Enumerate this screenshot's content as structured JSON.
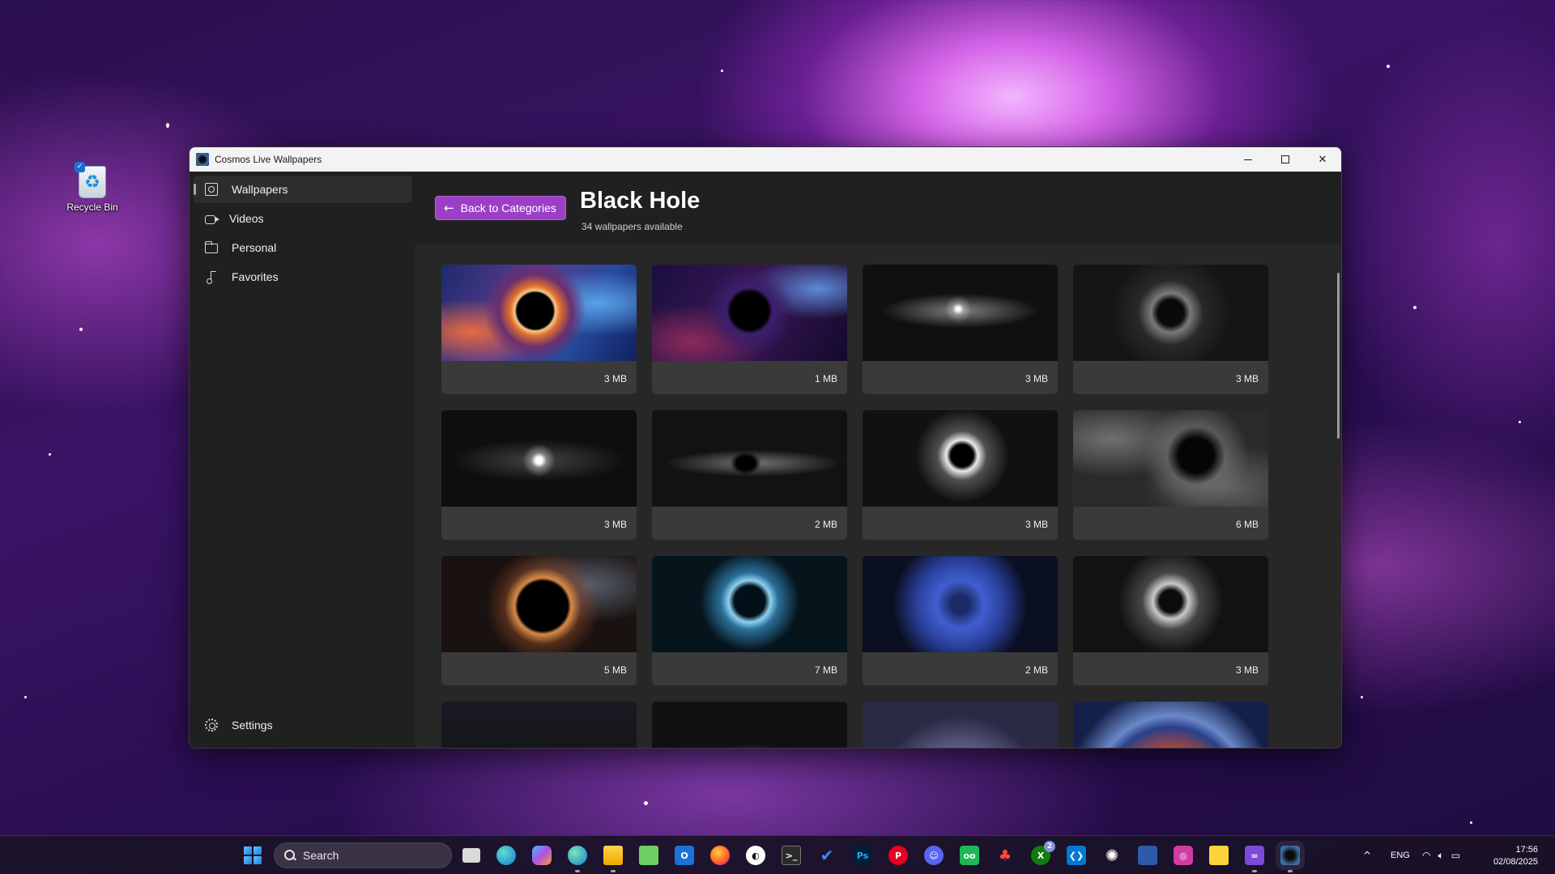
{
  "desktop": {
    "icons": [
      {
        "label": "Recycle Bin",
        "icon": "recycle-bin-icon"
      }
    ]
  },
  "window": {
    "title": "Cosmos Live Wallpapers",
    "controls": {
      "minimize": "minimize-icon",
      "maximize": "maximize-icon",
      "close": "close-icon"
    }
  },
  "sidebar": {
    "items": [
      {
        "label": "Wallpapers",
        "icon": "photo-icon",
        "active": true
      },
      {
        "label": "Videos",
        "icon": "video-icon",
        "active": false
      },
      {
        "label": "Personal",
        "icon": "folder-icon",
        "active": false
      },
      {
        "label": "Favorites",
        "icon": "music-note-icon",
        "active": false
      }
    ],
    "settings_label": "Settings"
  },
  "header": {
    "back_label": "Back to Categories",
    "title": "Black Hole",
    "subtitle": "34 wallpapers available",
    "accent_color": "#9b3fc7"
  },
  "wallpapers": [
    {
      "size": "3 MB"
    },
    {
      "size": "1 MB"
    },
    {
      "size": "3 MB"
    },
    {
      "size": "3 MB"
    },
    {
      "size": "3 MB"
    },
    {
      "size": "2 MB"
    },
    {
      "size": "3 MB"
    },
    {
      "size": "6 MB"
    },
    {
      "size": "5 MB"
    },
    {
      "size": "7 MB"
    },
    {
      "size": "2 MB"
    },
    {
      "size": "3 MB"
    },
    {
      "size": ""
    },
    {
      "size": ""
    },
    {
      "size": ""
    },
    {
      "size": ""
    }
  ],
  "taskbar": {
    "search_placeholder": "Search",
    "apps": [
      "task-view-icon",
      "edge-icon",
      "copilot-icon",
      "edge-dev-icon",
      "file-explorer-icon",
      "notepad-icon",
      "outlook-icon",
      "firefox-icon",
      "app-icon",
      "terminal-icon",
      "todo-icon",
      "photoshop-icon",
      "pinterest-icon",
      "discord-icon",
      "app-green-icon",
      "app-red-icon",
      "xbox-icon",
      "vscode-icon",
      "chatgpt-icon",
      "app-blue-icon",
      "app-pink-icon",
      "sticky-notes-icon",
      "visual-studio-icon",
      "cosmos-wallpapers-icon"
    ],
    "xbox_badge": "2",
    "tray": {
      "language": "ENG"
    },
    "clock": {
      "time": "17:56",
      "date": "02/08/2025"
    }
  }
}
